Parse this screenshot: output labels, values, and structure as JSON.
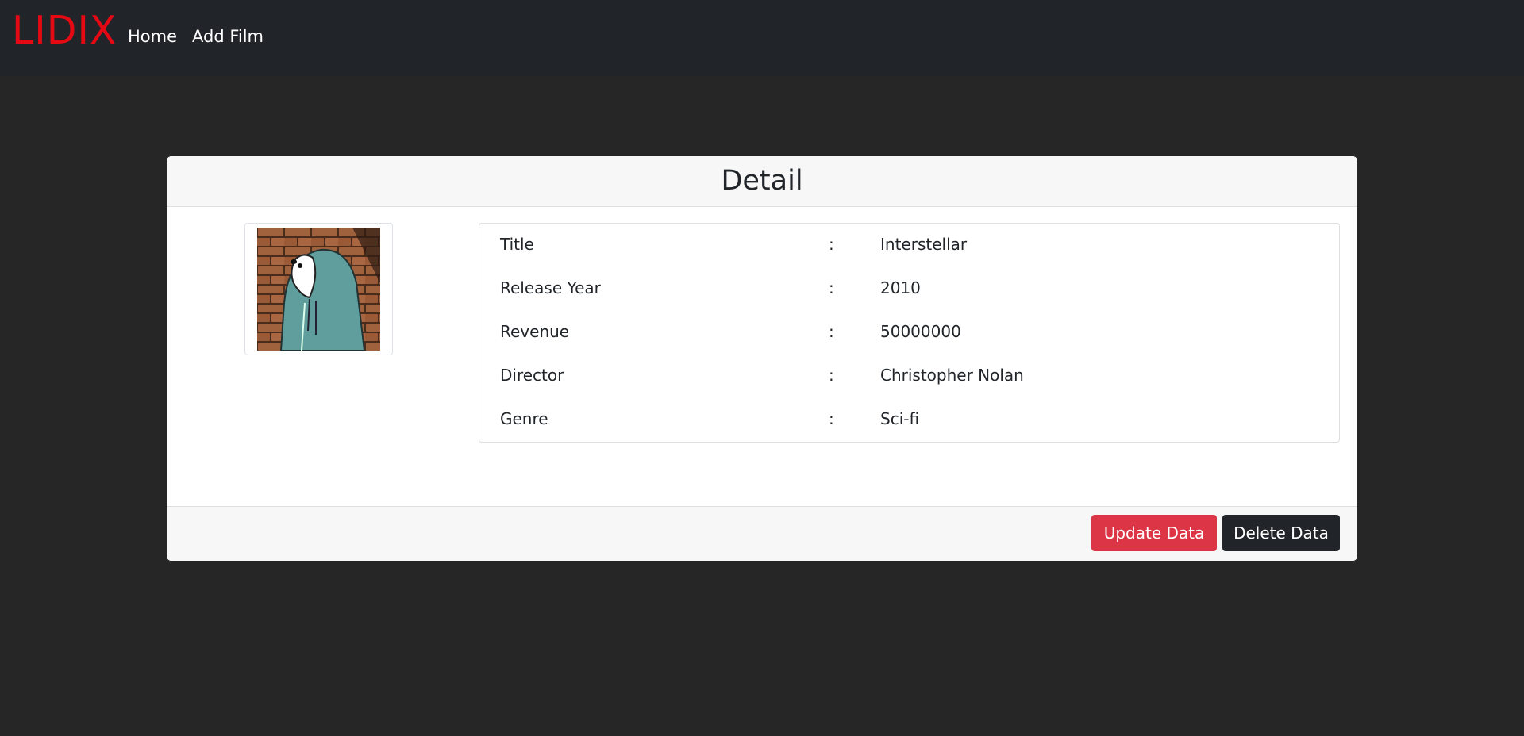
{
  "nav": {
    "brand": "LIDIX",
    "links": [
      {
        "label": "Home"
      },
      {
        "label": "Add Film"
      }
    ]
  },
  "card": {
    "title": "Detail",
    "fields": [
      {
        "label": "Title",
        "separator": ":",
        "value": "Interstellar"
      },
      {
        "label": "Release Year",
        "separator": ":",
        "value": "2010"
      },
      {
        "label": "Revenue",
        "separator": ":",
        "value": "50000000"
      },
      {
        "label": "Director",
        "separator": ":",
        "value": "Christopher Nolan"
      },
      {
        "label": "Genre",
        "separator": ":",
        "value": "Sci-fi"
      }
    ],
    "buttons": {
      "update_label": "Update Data",
      "delete_label": "Delete Data"
    }
  },
  "colors": {
    "brand": "#e50914",
    "navbar_bg": "#212429",
    "page_bg": "#262626",
    "update_button": "#dc3545",
    "delete_button": "#212529"
  },
  "poster": {
    "icon": "hooded-bear-poster-image"
  }
}
